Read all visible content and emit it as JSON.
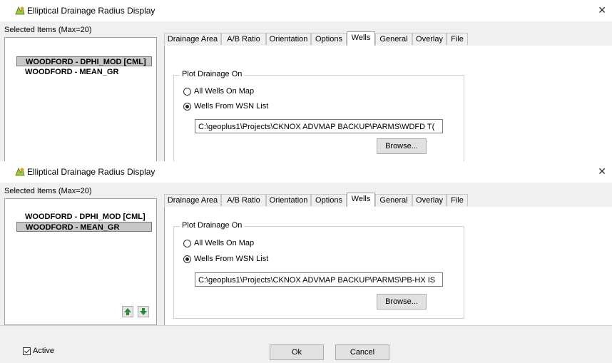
{
  "windows": [
    {
      "title": "Elliptical Drainage Radius Display",
      "selected_label": "Selected Items (Max=20)",
      "items": [
        {
          "label": "WOODFORD - DPHI_MOD [CML]",
          "selected": true
        },
        {
          "label": "WOODFORD - MEAN_GR",
          "selected": false
        }
      ],
      "tabs": [
        "Drainage Area",
        "A/B Ratio",
        "Orientation",
        "Options",
        "Wells",
        "General",
        "Overlay",
        "File"
      ],
      "active_tab": "Wells",
      "group_title": "Plot Drainage On",
      "radio_all": "All Wells On Map",
      "radio_wsn": "Wells From WSN List",
      "selected_radio": "wsn",
      "path": "C:\\geoplus1\\Projects\\CKNOX ADVMAP BACKUP\\PARMS\\WDFD T(",
      "browse_label": "Browse..."
    },
    {
      "title": "Elliptical Drainage Radius Display",
      "selected_label": "Selected Items (Max=20)",
      "items": [
        {
          "label": "WOODFORD - DPHI_MOD [CML]",
          "selected": false
        },
        {
          "label": "WOODFORD - MEAN_GR",
          "selected": true
        }
      ],
      "tabs": [
        "Drainage Area",
        "A/B Ratio",
        "Orientation",
        "Options",
        "Wells",
        "General",
        "Overlay",
        "File"
      ],
      "active_tab": "Wells",
      "group_title": "Plot Drainage On",
      "radio_all": "All Wells On Map",
      "radio_wsn": "Wells From WSN List",
      "selected_radio": "wsn",
      "path": "C:\\geoplus1\\Projects\\CKNOX ADVMAP BACKUP\\PARMS\\PB-HX IS",
      "browse_label": "Browse..."
    }
  ],
  "footer": {
    "active_label": "Active",
    "active_checked": true,
    "ok_label": "Ok",
    "cancel_label": "Cancel"
  },
  "icons": {
    "app": "drainage-app-icon",
    "close": "close-icon",
    "up": "arrow-up-icon",
    "down": "arrow-down-icon"
  },
  "colors": {
    "arrow_green": "#2e8b3a",
    "selection": "#c8c8c8"
  }
}
